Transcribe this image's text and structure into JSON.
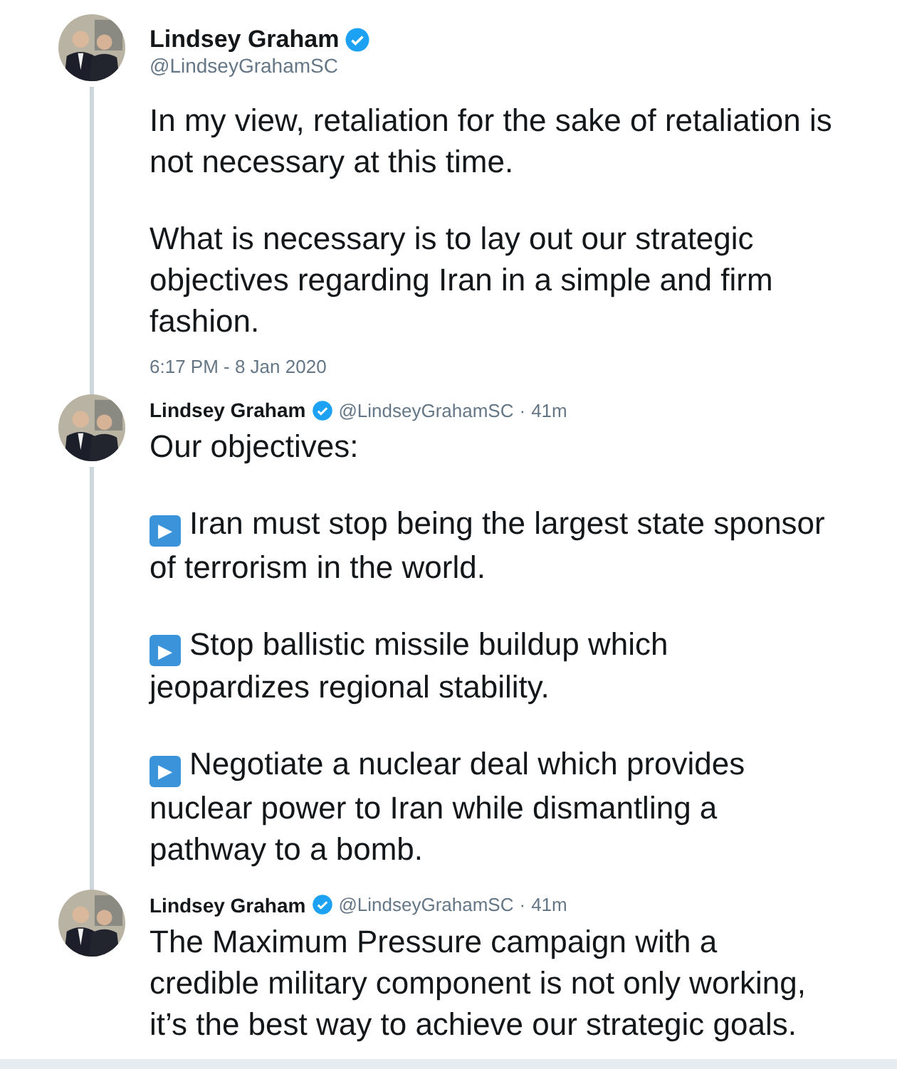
{
  "tweets": [
    {
      "kind": "main",
      "name": "Lindsey Graham",
      "verified": true,
      "handle": "@LindseyGrahamSC",
      "paragraphs": [
        {
          "kind": "text",
          "text": "In my view, retaliation for the sake of retaliation is not necessary at this time."
        },
        {
          "kind": "text",
          "text": "What is necessary is to lay out our strategic objectives regarding Iran in a simple and firm fashion."
        }
      ],
      "timestamp": "6:17 PM - 8 Jan 2020"
    },
    {
      "kind": "reply",
      "name": "Lindsey Graham",
      "verified": true,
      "handle": "@LindseyGrahamSC",
      "separator": "·",
      "time": "41m",
      "paragraphs": [
        {
          "kind": "text",
          "text": "Our objectives:"
        },
        {
          "kind": "bullet",
          "icon": "▶",
          "text": "Iran must stop being the largest state sponsor of terrorism in the world."
        },
        {
          "kind": "bullet",
          "icon": "▶",
          "text": "Stop ballistic missile buildup which jeopardizes regional stability."
        },
        {
          "kind": "bullet",
          "icon": "▶",
          "text": "Negotiate a nuclear deal which provides nuclear power to Iran while dismantling a pathway to a bomb."
        }
      ]
    },
    {
      "kind": "reply",
      "name": "Lindsey Graham",
      "verified": true,
      "handle": "@LindseyGrahamSC",
      "separator": "·",
      "time": "41m",
      "paragraphs": [
        {
          "kind": "text",
          "text": "The Maximum Pressure campaign with a credible military component is not only working, it’s the best way to achieve our strategic goals."
        }
      ]
    }
  ]
}
